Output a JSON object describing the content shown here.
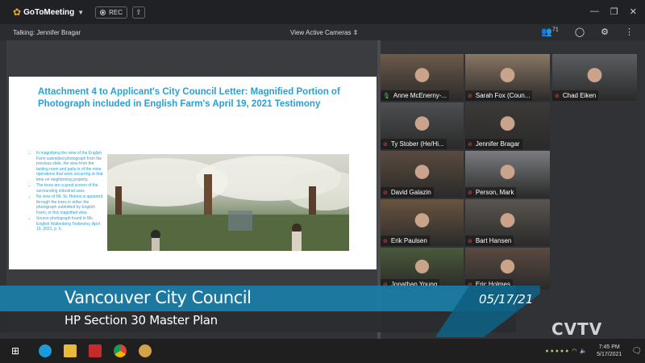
{
  "app": {
    "name": "GoToMeeting",
    "rec_label": "REC"
  },
  "infobar": {
    "talking": "Talking: Jennifer Bragar",
    "view_cameras": "View Active Cameras",
    "attendee_count": "71"
  },
  "slide": {
    "title": "Attachment 4 to Applicant's City Council Letter:  Magnified Portion of Photograph included in English Farm's April 19, 2021 Testimony",
    "bullets": [
      "In magnifying the view of the English Farm submitted photograph from the previous slide, the view from the tasting room and patio is of the mine operations that were occurring at that time on neighboring property.",
      "The trees are a good screen of the surrounding industrial uses.",
      "No view of Mt. St. Helens is apparent through the trees in either the photograph submitted by English Farm, or this magnified view.",
      "Source photograph found in Ms. English Wallenberg Testimony, April 19, 2021, p. 6."
    ]
  },
  "participants": [
    {
      "name": "Anne McEnerny-...",
      "mic": "on"
    },
    {
      "name": "Sarah Fox (Coun...",
      "mic": "off"
    },
    {
      "name": "Chad Eiken",
      "mic": "off"
    },
    {
      "name": "Ty Stober (He/Hi...",
      "mic": "off"
    },
    {
      "name": "Jennifer Bragar",
      "mic": "off"
    },
    {
      "name": "David Galazin",
      "mic": "off"
    },
    {
      "name": "Person, Mark",
      "mic": "off"
    },
    {
      "name": "Erik Paulsen",
      "mic": "off"
    },
    {
      "name": "Bart Hansen",
      "mic": "off"
    },
    {
      "name": "Jonathan Young",
      "mic": "off"
    },
    {
      "name": "Eric Holmes",
      "mic": "off"
    }
  ],
  "lower_third": {
    "title": "Vancouver City Council",
    "subtitle": "HP Section 30 Master Plan",
    "date": "05/17/21"
  },
  "watermark": "CVTV",
  "taskbar": {
    "time": "7:45 PM",
    "date": "5/17/2021"
  },
  "colors": {
    "accent": "#1b7ea8",
    "slide_title": "#2a9fd6",
    "mic_off": "#e24b4b",
    "mic_on": "#3ecf6e"
  }
}
